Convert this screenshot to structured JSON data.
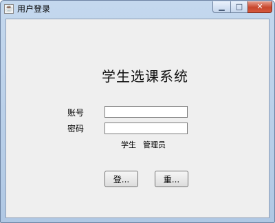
{
  "window": {
    "title": "用户登录",
    "app_icon_glyph": "☕",
    "app_icon_name": "java-icon",
    "minimize_glyph": "▁",
    "maximize_glyph": "□",
    "close_glyph": "✕"
  },
  "form": {
    "system_title": "学生选课系统",
    "account_label": "账号",
    "account_value": "",
    "password_label": "密码",
    "password_value": "",
    "roles": [
      "学生",
      "管理员"
    ],
    "login_label": "登...",
    "reset_label": "重..."
  },
  "colors": {
    "titlebar": "#b9cfe9",
    "client_bg": "#efefef",
    "close_button": "#c7462c"
  }
}
